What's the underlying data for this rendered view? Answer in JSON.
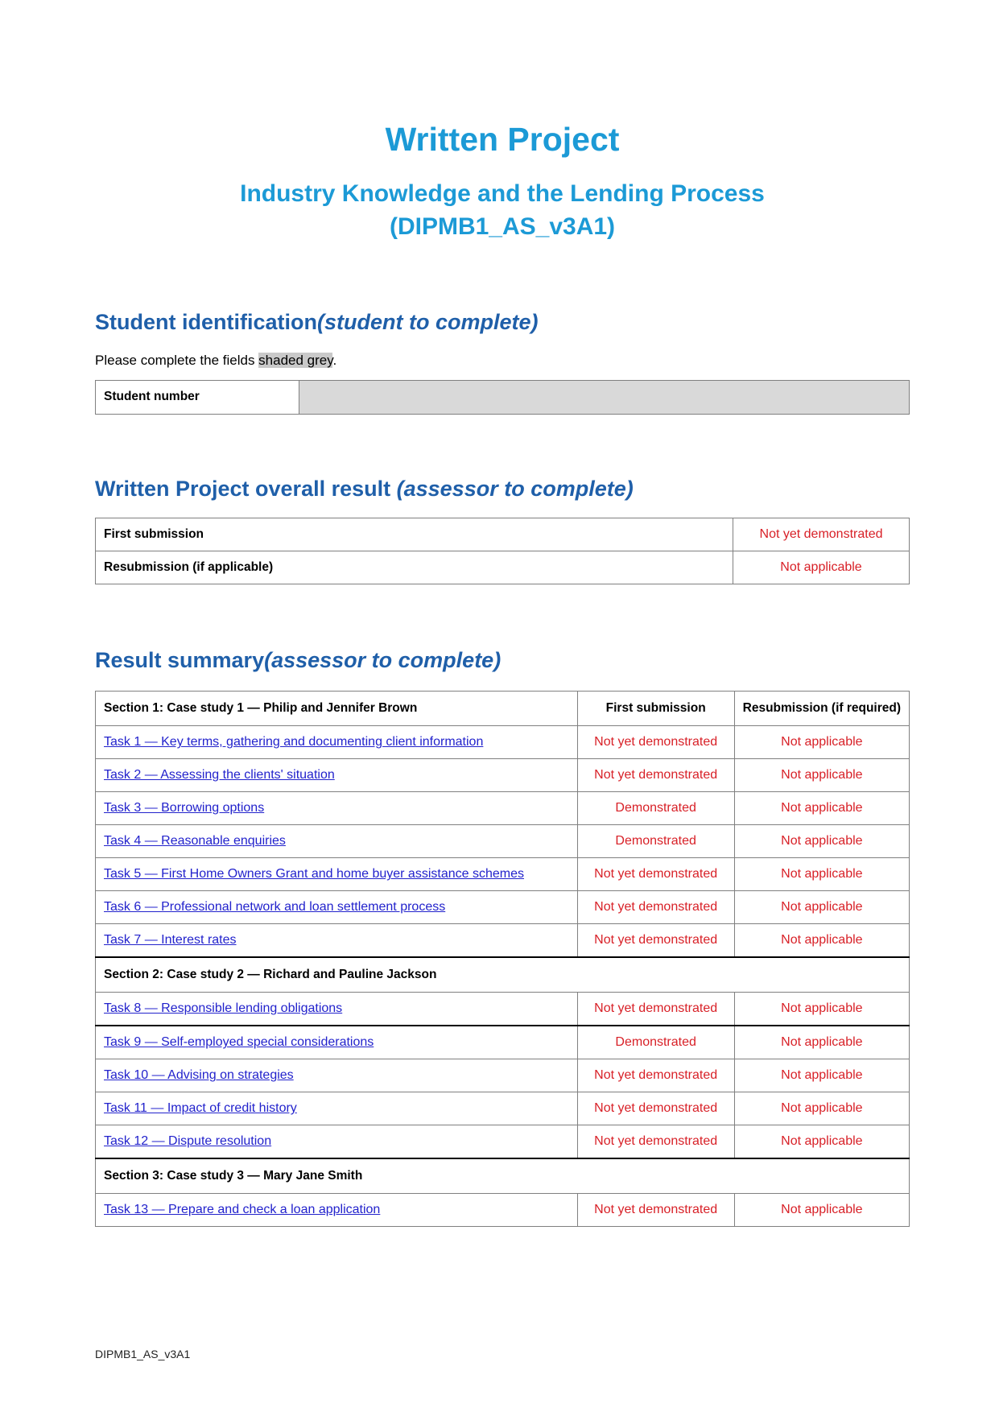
{
  "document": {
    "title": "Written Project",
    "subtitle_line1": "Industry Knowledge and the Lending Process",
    "subtitle_line2": "(DIPMB1_AS_v3A1)",
    "footer": "DIPMB1_AS_v3A1"
  },
  "student_identification": {
    "heading_main": "Student identification",
    "heading_italic": "(student to complete)",
    "instruction_prefix": "Please complete the fields ",
    "instruction_highlight": "shaded grey",
    "instruction_suffix": ".",
    "field_label": "Student number",
    "field_value": ""
  },
  "overall_result": {
    "heading_main": "Written Project overall result ",
    "heading_italic": "(assessor to complete)",
    "rows": [
      {
        "label": "First submission",
        "result": "Not yet demonstrated"
      },
      {
        "label": "Resubmission (if applicable)",
        "result": "Not applicable"
      }
    ]
  },
  "result_summary": {
    "heading_main": "Result summary",
    "heading_italic": "(assessor to complete)",
    "columns": {
      "first_submission": "First submission",
      "resubmission": "Resubmission (if required)"
    },
    "sections": [
      {
        "title": "Section 1: Case study 1 — Philip and Jennifer Brown",
        "tasks": [
          {
            "name": "Task 1 — Key terms, gathering and documenting client information",
            "first": "Not yet demonstrated",
            "resub": "Not applicable"
          },
          {
            "name": "Task 2 — Assessing the clients' situation",
            "first": "Not yet demonstrated",
            "resub": "Not applicable"
          },
          {
            "name": "Task 3 — Borrowing options",
            "first": "Demonstrated",
            "resub": "Not applicable"
          },
          {
            "name": "Task 4 — Reasonable enquiries",
            "first": "Demonstrated",
            "resub": "Not applicable"
          },
          {
            "name": "Task 5 — First Home Owners Grant and home buyer assistance schemes",
            "first": "Not yet demonstrated",
            "resub": "Not applicable"
          },
          {
            "name": "Task 6 — Professional network and loan settlement process",
            "first": "Not yet demonstrated",
            "resub": "Not applicable"
          },
          {
            "name": "Task 7 — Interest rates",
            "first": "Not yet demonstrated",
            "resub": "Not applicable"
          }
        ]
      },
      {
        "title": "Section 2: Case study 2 — Richard and Pauline Jackson",
        "tasks": [
          {
            "name": "Task 8 — Responsible lending obligations",
            "first": "Not yet demonstrated",
            "resub": "Not applicable"
          },
          {
            "name": "Task 9 — Self-employed special considerations",
            "first": "Demonstrated",
            "resub": "Not applicable"
          },
          {
            "name": "Task 10 — Advising on strategies",
            "first": "Not yet demonstrated",
            "resub": "Not applicable"
          },
          {
            "name": "Task 11 — Impact of credit history",
            "first": "Not yet demonstrated",
            "resub": "Not applicable"
          },
          {
            "name": "Task 12 — Dispute resolution",
            "first": "Not yet demonstrated",
            "resub": "Not applicable"
          }
        ]
      },
      {
        "title": "Section 3: Case study 3 — Mary Jane Smith",
        "tasks": [
          {
            "name": "Task 13 — Prepare and check a loan application",
            "first": "Not yet demonstrated",
            "resub": "Not applicable"
          }
        ]
      }
    ]
  },
  "colors": {
    "title_blue": "#1C9AD6",
    "heading_blue": "#1F5FA9",
    "link_blue": "#2222CC",
    "result_red": "#D82027",
    "shaded_grey": "#D9D9D9",
    "highlight_grey": "#C9C9C9"
  }
}
